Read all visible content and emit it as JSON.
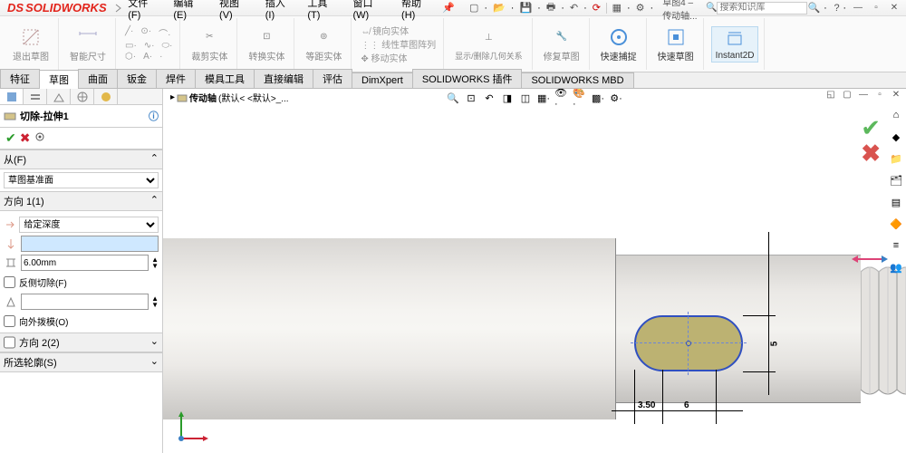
{
  "app": {
    "name": "SOLIDWORKS",
    "doc_prefix": "草图4 – 传动轴...",
    "search_placeholder": "搜索知识库"
  },
  "menu": [
    "文件(F)",
    "编辑(E)",
    "视图(V)",
    "插入(I)",
    "工具(T)",
    "窗口(W)",
    "帮助(H)"
  ],
  "ribbon": {
    "exit": "退出草图",
    "smart": "智能尺寸",
    "trim": "裁剪实体",
    "convert": "转换实体",
    "offset": "等距实体",
    "mirror": "镜向实体",
    "pattern": "线性草图阵列",
    "move": "移动实体",
    "geom": "显示/删除几何关系",
    "repair": "修复草图",
    "snap": "快速捕捉",
    "quick": "快速草图",
    "inst": "Instant2D"
  },
  "tabs": [
    "特征",
    "草图",
    "曲面",
    "钣金",
    "焊件",
    "模具工具",
    "直接编辑",
    "评估",
    "DimXpert",
    "SOLIDWORKS 插件",
    "SOLIDWORKS MBD"
  ],
  "bc": {
    "part": "传动轴",
    "cfg": "(默认< <默认>_..."
  },
  "pm": {
    "title": "切除-拉伸1",
    "from": "从(F)",
    "from_val": "草图基准面",
    "dir1": "方向 1(1)",
    "dir1_type": "给定深度",
    "depth": "6.00mm",
    "flip": "反侧切除(F)",
    "draft": "向外拨模(O)",
    "dir2": "方向 2(2)",
    "contours": "所选轮廓(S)"
  },
  "dims": {
    "d1": "3.50",
    "d2": "6",
    "d3": "5"
  }
}
